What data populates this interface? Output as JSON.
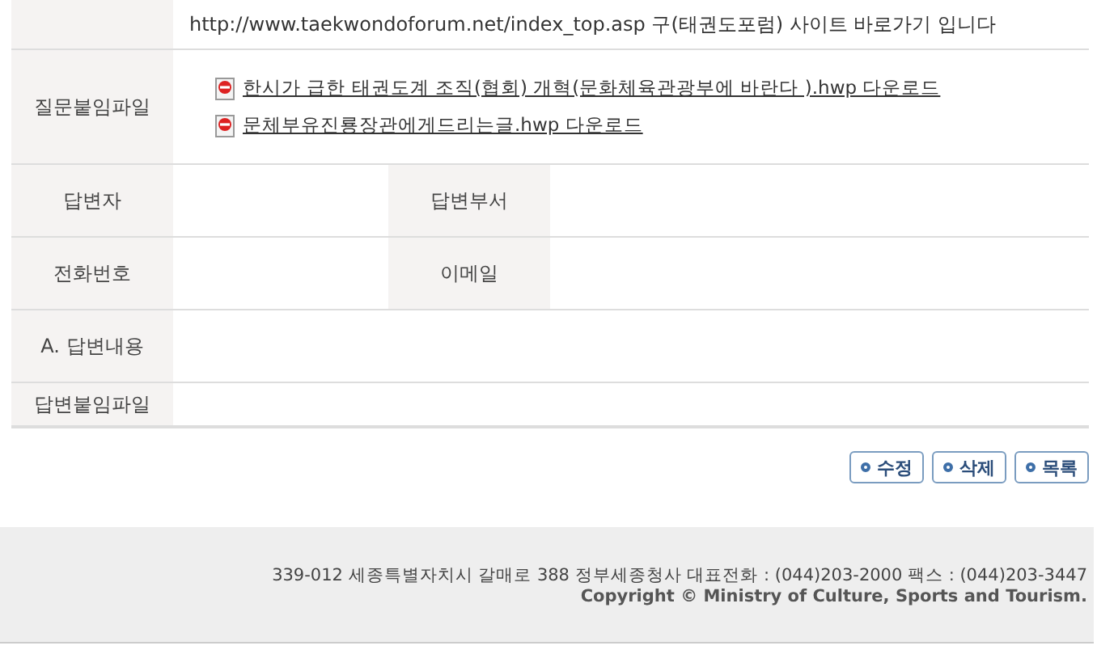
{
  "table": {
    "rows": [
      {
        "kind": "text",
        "label": "",
        "value": "http://www.taekwondoforum.net/index_top.asp 구(태권도포럼) 사이트 바로가기 입니다"
      },
      {
        "kind": "files",
        "label": "질문붙임파일",
        "files": [
          "한시가 급한 태권도계 조직(협회) 개혁(문화체육관광부에 바란다 ).hwp 다운로드",
          "문체부유진룡장관에게드리는글.hwp 다운로드"
        ]
      },
      {
        "kind": "pair",
        "label": "답변자",
        "value": "",
        "label2": "답변부서",
        "value2": ""
      },
      {
        "kind": "pair",
        "label": "전화번호",
        "value": "",
        "label2": "이메일",
        "value2": ""
      },
      {
        "kind": "text",
        "label": "A. 답변내용",
        "value": ""
      },
      {
        "kind": "text",
        "label": "답변붙임파일",
        "value": ""
      }
    ]
  },
  "buttons": [
    "수정",
    "삭제",
    "목록"
  ],
  "footer": {
    "address": "339-012 세종특별자치시 갈매로 388 정부세종청사  대표전화 : (044)203-2000  팩스 : (044)203-3447",
    "copyright": "Copyright © Ministry of Culture, Sports and Tourism."
  }
}
